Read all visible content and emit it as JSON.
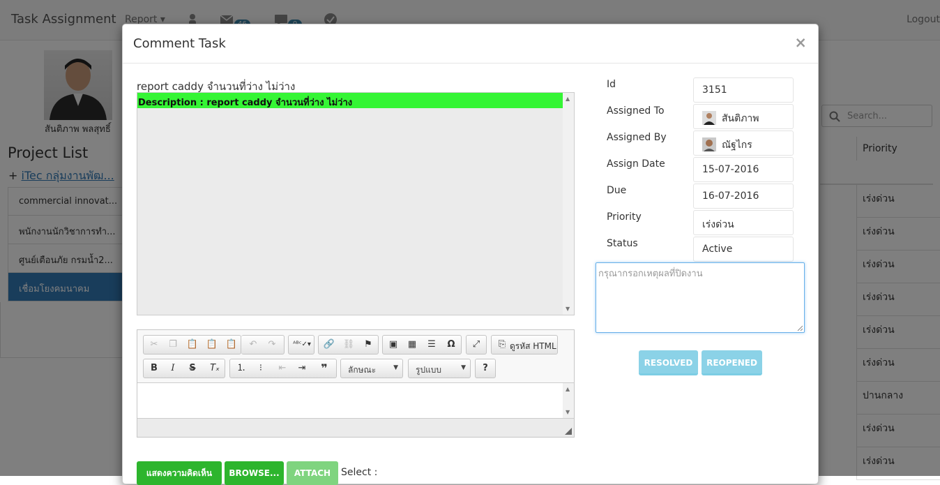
{
  "app": {
    "brand": "Task Assignment",
    "nav_report": "Report",
    "mail_badge": "46",
    "chat_badge": "0",
    "logout": "Logout"
  },
  "profile": {
    "name": "สันติภาพ พลสุทธิ์"
  },
  "projects": {
    "title": "Project List",
    "group_prefix": "+",
    "group_name": "iTec กลุ่มงานพัฒ...",
    "items": [
      "commercial innovat...",
      "พนักงานนักวิชาการทำ...",
      "ศูนย์เตือนภัย กรมน้ำ2...",
      "เชื่อมโยงคมนาคม"
    ]
  },
  "table": {
    "search_placeholder": "Search...",
    "priority_header": "Priority",
    "priority_values": [
      "เร่งด่วน",
      "เร่งด่วน",
      "เร่งด่วน",
      "เร่งด่วน",
      "เร่งด่วน",
      "เร่งด่วน",
      "ปานกลาง",
      "เร่งด่วน",
      "เร่งด่วน"
    ]
  },
  "modal": {
    "title": "Comment Task",
    "close": "×",
    "task_title": "report caddy จำนวนที่ว่าง ไม่ว่าง",
    "description": "Description : report caddy จำนวนที่ว่าง ไม่ว่าง",
    "editor": {
      "source_label": "ดูรหัส HTML",
      "style_label": "ลักษณะ",
      "format_label": "รูปแบบ"
    },
    "info": {
      "id_label": "Id",
      "id": "3151",
      "assigned_to_label": "Assigned To",
      "assigned_to": "สันติภาพ",
      "assigned_by_label": "Assigned By",
      "assigned_by": "ณัฐไกร",
      "assign_date_label": "Assign Date",
      "assign_date": "15-07-2016",
      "due_label": "Due",
      "due": "16-07-2016",
      "priority_label": "Priority",
      "priority": "เร่งด่วน",
      "status_label": "Status",
      "status": "Active"
    },
    "reason_placeholder": "กรุณากรอกเหตุผลที่ปิดงาน",
    "resolved": "RESOLVED",
    "reopened": "REOPENED",
    "show_comments": "แสดงความคิดเห็น",
    "browse": "BROWSE...",
    "attach": "ATTACH",
    "select_label": "Select :"
  }
}
